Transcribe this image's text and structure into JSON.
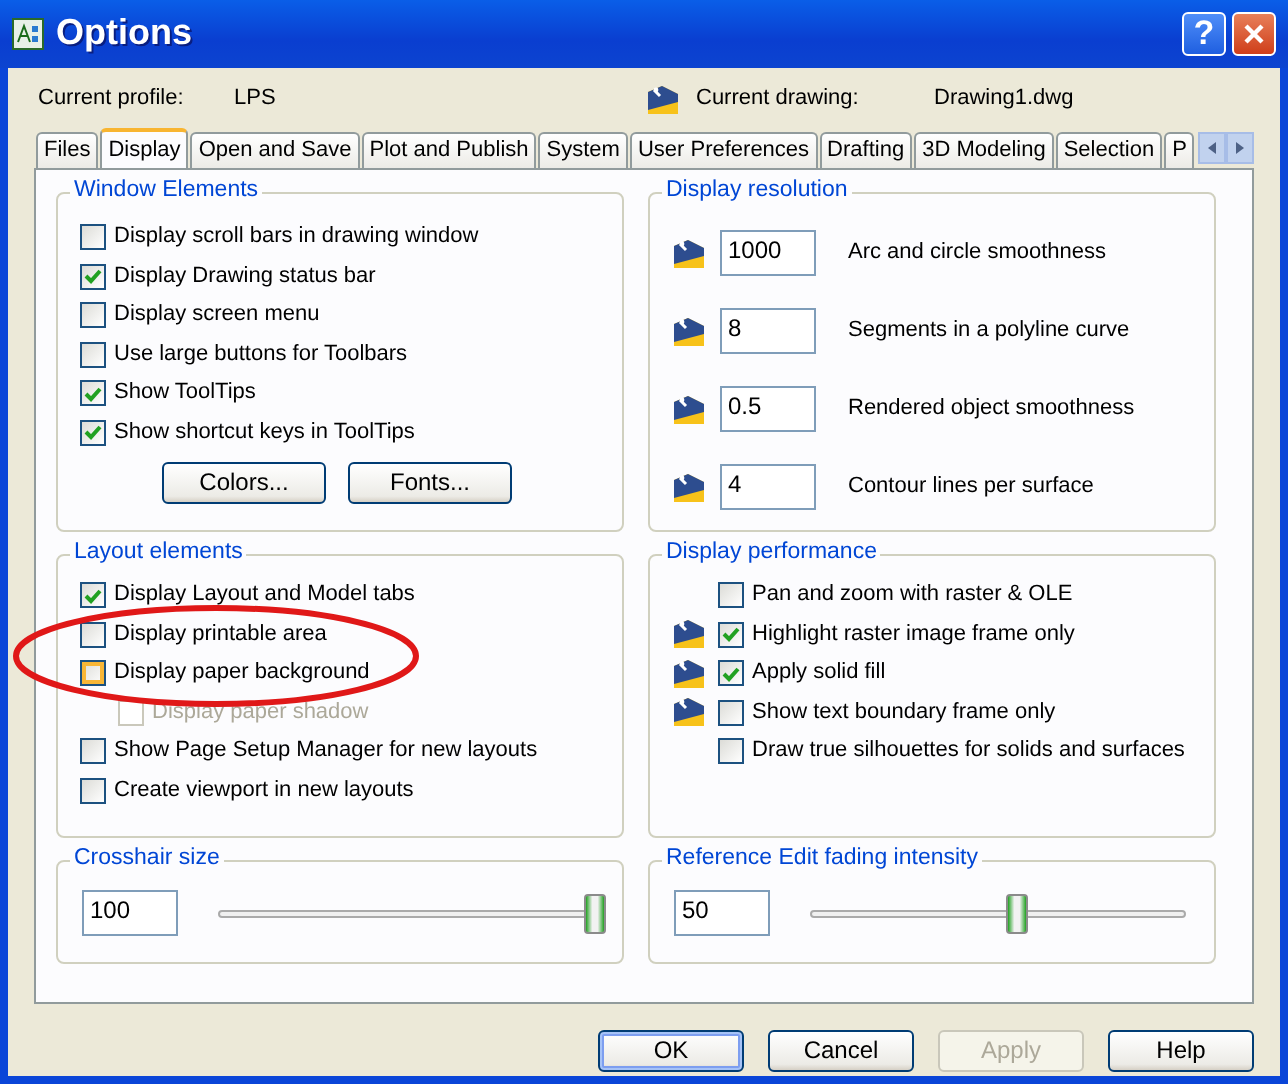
{
  "window": {
    "title": "Options",
    "help_glyph": "?"
  },
  "profile": {
    "label": "Current profile:",
    "value": "LPS"
  },
  "drawing": {
    "label": "Current drawing:",
    "value": "Drawing1.dwg"
  },
  "tabs": [
    {
      "label": "Files",
      "selected": false
    },
    {
      "label": "Display",
      "selected": true
    },
    {
      "label": "Open and Save",
      "selected": false
    },
    {
      "label": "Plot and Publish",
      "selected": false
    },
    {
      "label": "System",
      "selected": false
    },
    {
      "label": "User Preferences",
      "selected": false
    },
    {
      "label": "Drafting",
      "selected": false
    },
    {
      "label": "3D Modeling",
      "selected": false
    },
    {
      "label": "Selection",
      "selected": false
    },
    {
      "label": "P",
      "selected": false
    }
  ],
  "window_elements": {
    "title": "Window Elements",
    "items": [
      {
        "label": "Display scroll bars in drawing window",
        "checked": false
      },
      {
        "label": "Display Drawing status bar",
        "checked": true
      },
      {
        "label": "Display screen menu",
        "checked": false
      },
      {
        "label": "Use large buttons for Toolbars",
        "checked": false
      },
      {
        "label": "Show ToolTips",
        "checked": true
      },
      {
        "label": "Show shortcut keys in ToolTips",
        "checked": true
      }
    ],
    "buttons": [
      "Colors...",
      "Fonts..."
    ]
  },
  "display_resolution": {
    "title": "Display resolution",
    "rows": [
      {
        "value": "1000",
        "label": "Arc and circle smoothness"
      },
      {
        "value": "8",
        "label": "Segments in a polyline curve"
      },
      {
        "value": "0.5",
        "label": "Rendered object smoothness"
      },
      {
        "value": "4",
        "label": "Contour lines per surface"
      }
    ]
  },
  "layout_elements": {
    "title": "Layout elements",
    "items": [
      {
        "label": "Display Layout and Model tabs",
        "checked": true,
        "disabled": false,
        "hovered": false
      },
      {
        "label": "Display printable area",
        "checked": false,
        "disabled": false,
        "hovered": false
      },
      {
        "label": "Display paper background",
        "checked": false,
        "disabled": false,
        "hovered": true,
        "children": [
          {
            "label": "Display paper shadow",
            "checked": false,
            "disabled": true,
            "hovered": false
          }
        ]
      },
      {
        "label": "Show Page Setup Manager for new layouts",
        "checked": false,
        "disabled": false,
        "hovered": false
      },
      {
        "label": "Create viewport in new layouts",
        "checked": false,
        "disabled": false,
        "hovered": false
      }
    ]
  },
  "display_performance": {
    "title": "Display performance",
    "items": [
      {
        "label": "Pan and zoom with raster & OLE",
        "checked": false,
        "drawing_setting": false
      },
      {
        "label": "Highlight raster image frame only",
        "checked": true,
        "drawing_setting": true
      },
      {
        "label": "Apply solid fill",
        "checked": true,
        "drawing_setting": true
      },
      {
        "label": "Show text boundary frame only",
        "checked": false,
        "drawing_setting": true
      },
      {
        "label": "Draw true silhouettes for solids and surfaces",
        "checked": false,
        "drawing_setting": false
      }
    ]
  },
  "crosshair": {
    "title": "Crosshair size",
    "value": "100",
    "level": 1.0
  },
  "fading": {
    "title": "Reference Edit fading intensity",
    "value": "50",
    "level": 0.55
  },
  "buttons": [
    {
      "label": "OK",
      "kind": "default",
      "disabled": false
    },
    {
      "label": "Cancel",
      "kind": "normal",
      "disabled": false
    },
    {
      "label": "Apply",
      "kind": "normal",
      "disabled": true
    },
    {
      "label": "Help",
      "kind": "normal",
      "disabled": false
    }
  ],
  "annotations": [
    {
      "kind": "ellipse"
    }
  ]
}
